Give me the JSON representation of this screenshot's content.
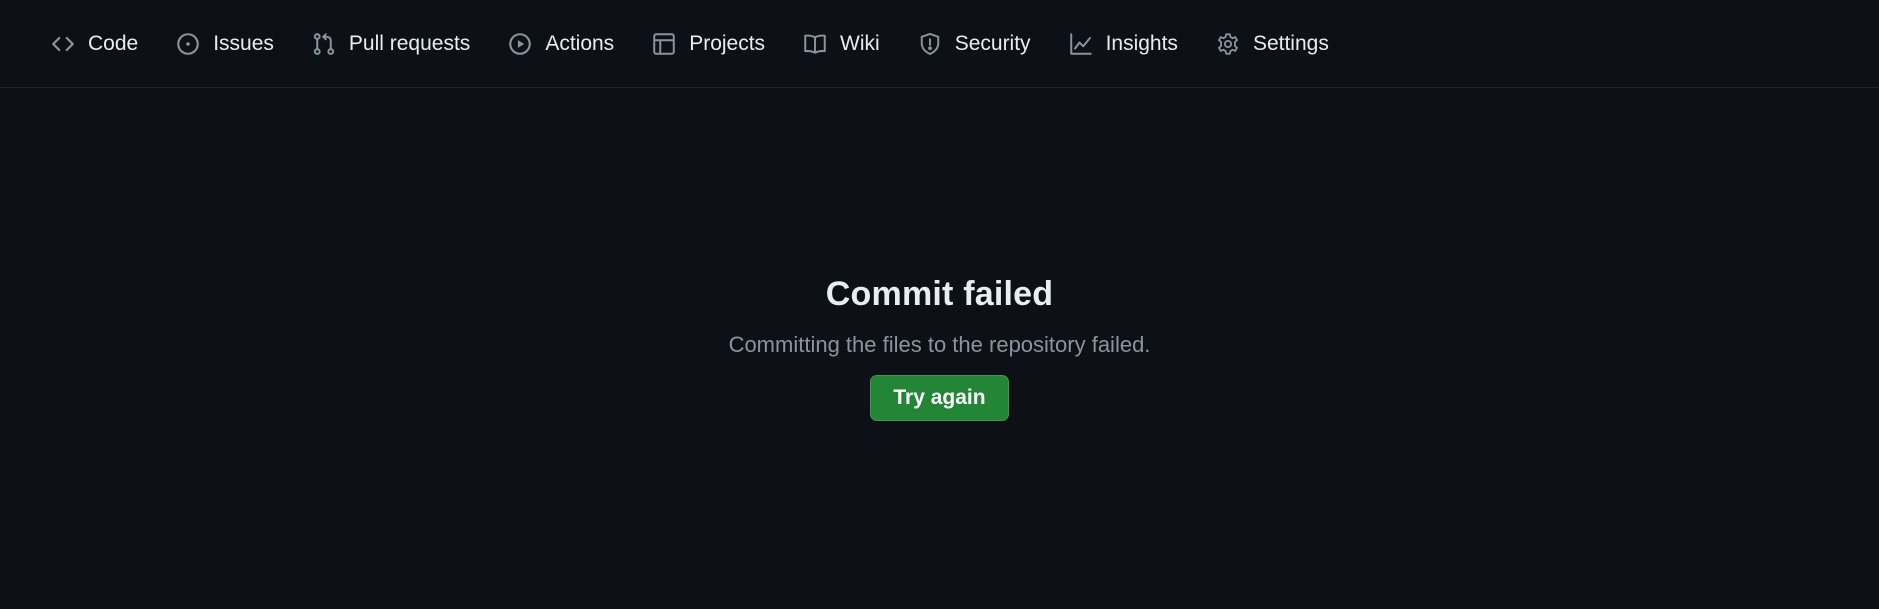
{
  "nav": {
    "items": [
      {
        "label": "Code",
        "icon": "code-icon"
      },
      {
        "label": "Issues",
        "icon": "issue-opened-icon"
      },
      {
        "label": "Pull requests",
        "icon": "git-pull-request-icon"
      },
      {
        "label": "Actions",
        "icon": "play-icon"
      },
      {
        "label": "Projects",
        "icon": "table-icon"
      },
      {
        "label": "Wiki",
        "icon": "book-icon"
      },
      {
        "label": "Security",
        "icon": "shield-icon"
      },
      {
        "label": "Insights",
        "icon": "graph-icon"
      },
      {
        "label": "Settings",
        "icon": "gear-icon"
      }
    ]
  },
  "blankslate": {
    "title": "Commit failed",
    "description": "Committing the files to the repository failed.",
    "button_label": "Try again"
  },
  "colors": {
    "background": "#0d1117",
    "border": "#21262d",
    "text": "#e6edf3",
    "muted": "#8b949e",
    "button": "#238636"
  }
}
